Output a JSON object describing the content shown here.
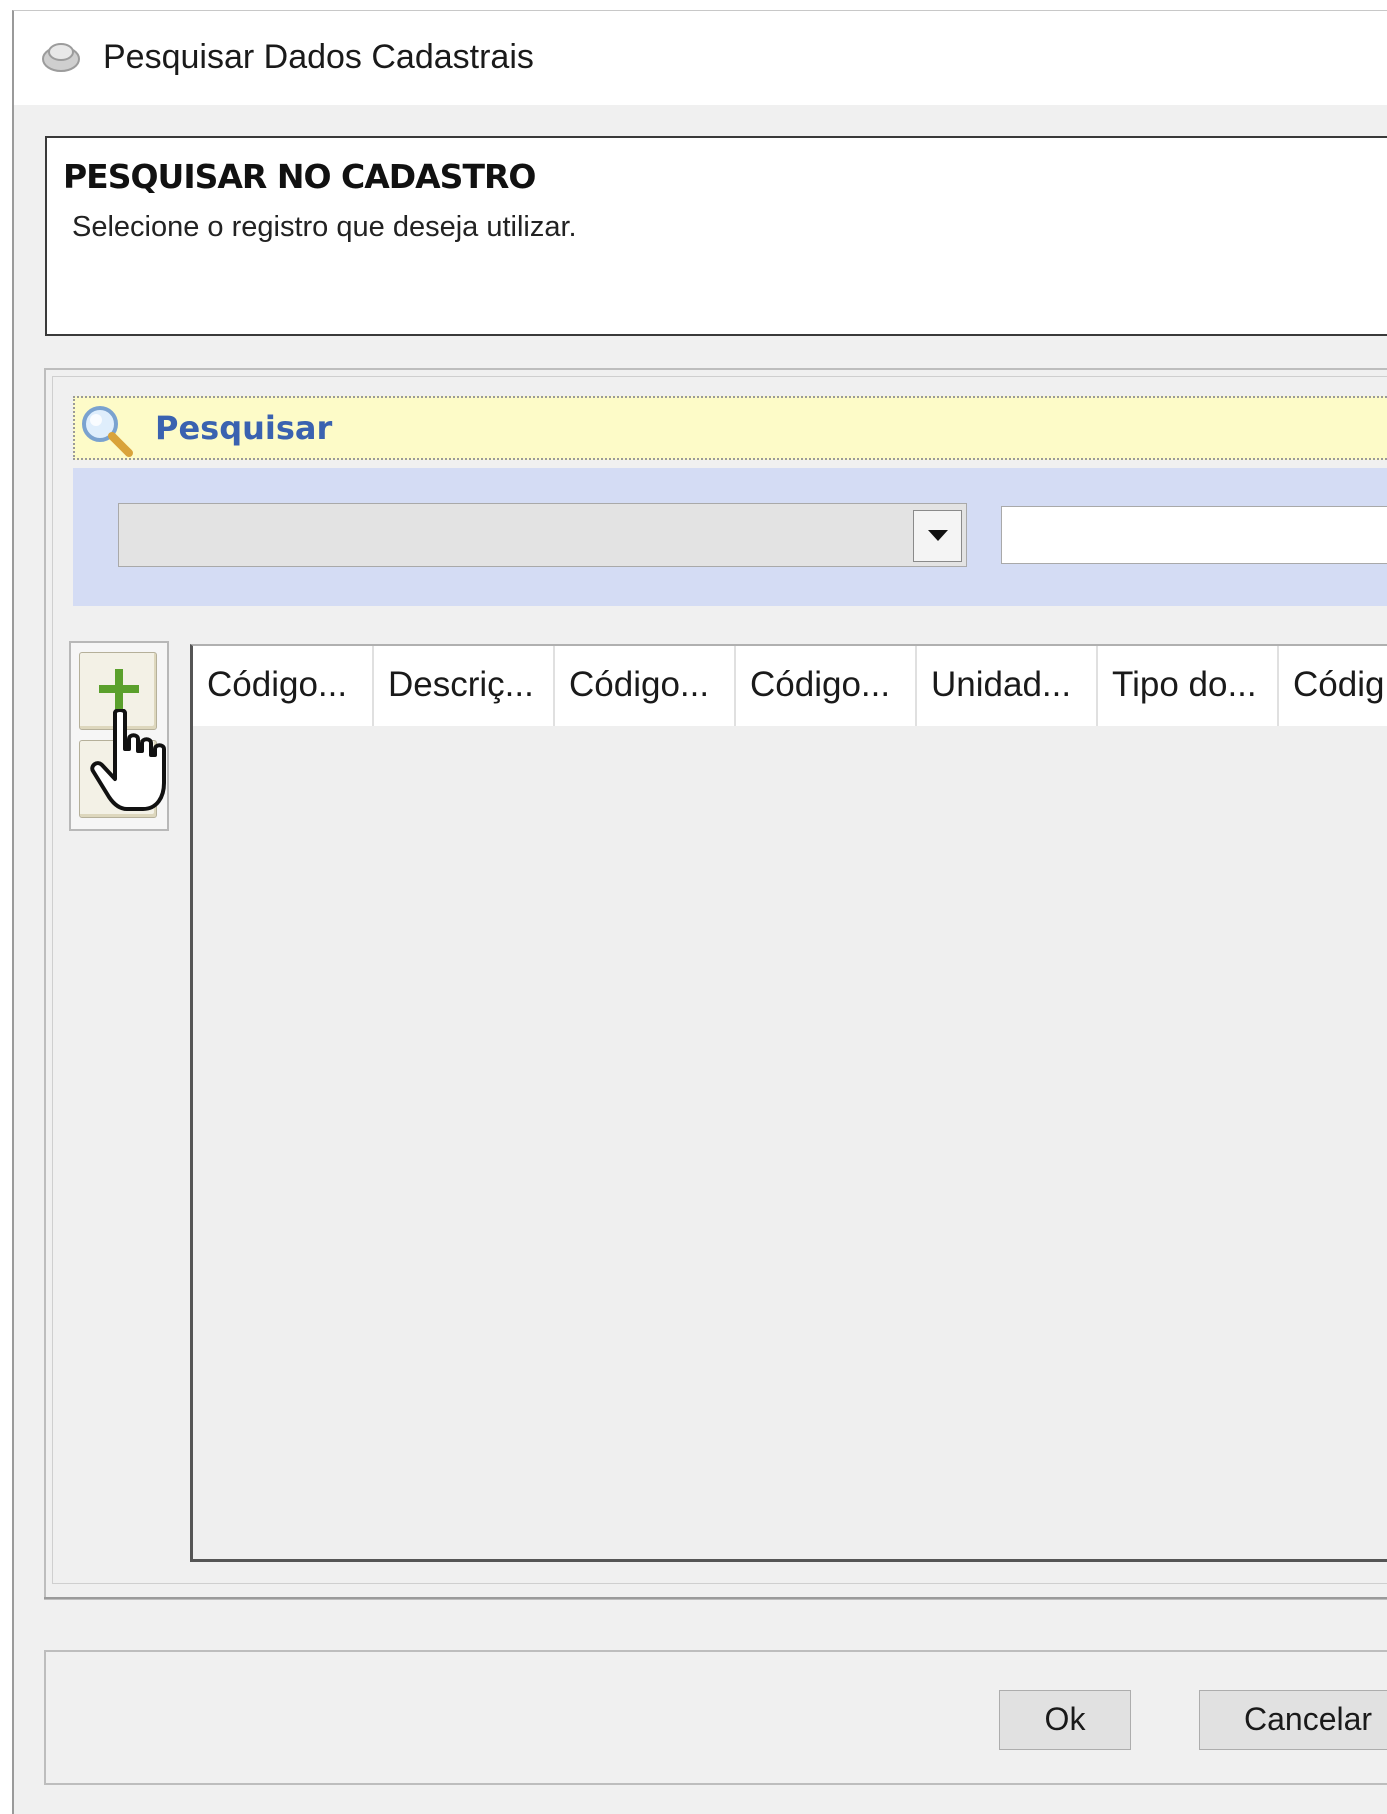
{
  "window": {
    "title": "Pesquisar Dados Cadastrais",
    "icon": "app-icon"
  },
  "header": {
    "title": "PESQUISAR NO CADASTRO",
    "subtitle": "Selecione o registro que deseja utilizar."
  },
  "search": {
    "label": "Pesquisar",
    "icon": "magnifier-icon",
    "field_selected": "",
    "input_value": ""
  },
  "toolbar": {
    "add_icon": "plus-icon"
  },
  "grid": {
    "columns": [
      "Código...",
      "Descriç...",
      "Código...",
      "Código...",
      "Unidad...",
      "Tipo do...",
      "Códig"
    ],
    "rows": []
  },
  "footer": {
    "ok_label": "Ok",
    "cancel_label": "Cancelar"
  },
  "colors": {
    "search_bar_bg": "#fdfbc8",
    "filter_area_bg": "#d4dcf4",
    "search_label": "#3a62b0"
  }
}
